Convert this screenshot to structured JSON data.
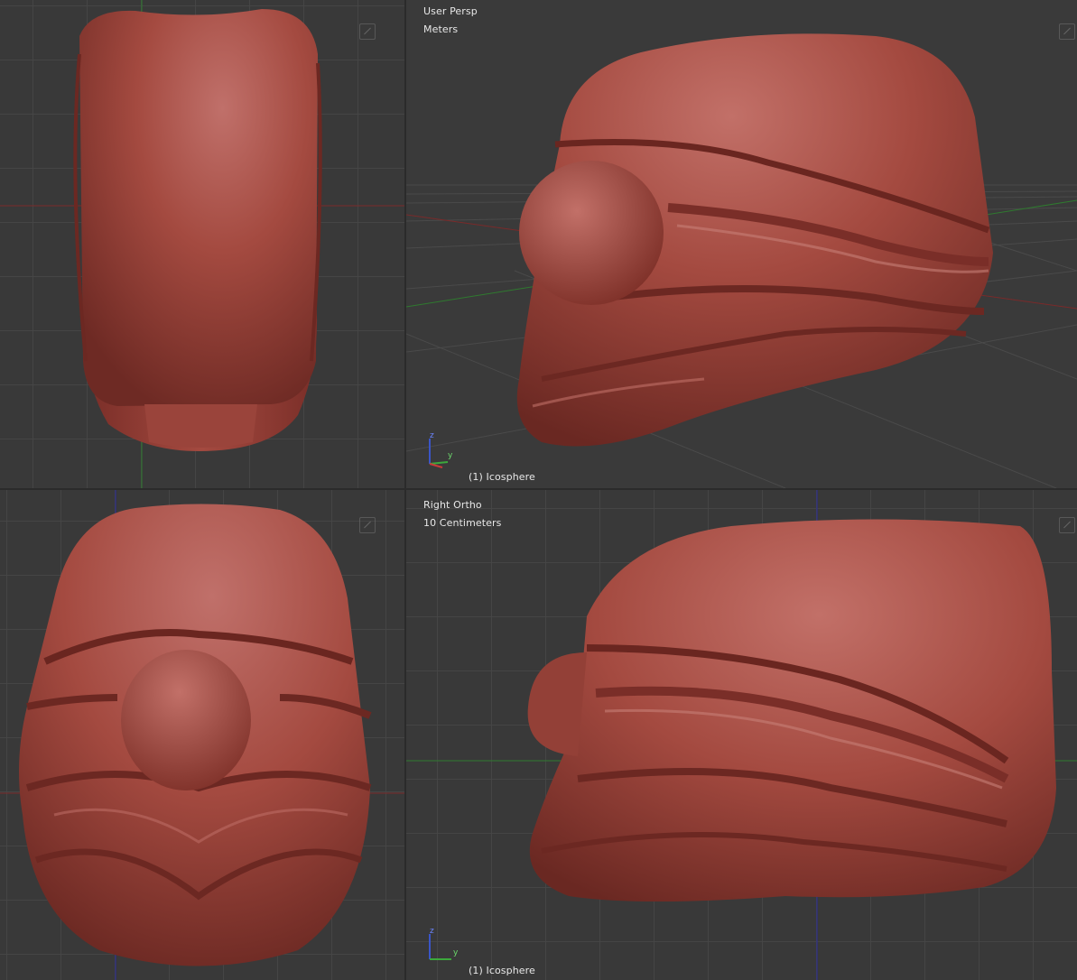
{
  "viewports": {
    "top_left": {
      "view_name": "",
      "object_name": ""
    },
    "top_right": {
      "view_name": "User Persp",
      "units": "Meters",
      "object_name": "(1) Icosphere",
      "axis_z": "z",
      "axis_y": "y"
    },
    "bottom_left": {
      "view_name": "",
      "object_name": ""
    },
    "bottom_right": {
      "view_name": "Right Ortho",
      "units": "10 Centimeters",
      "object_name": "(1) Icosphere",
      "axis_z": "z",
      "axis_y": "y"
    }
  },
  "colors": {
    "viewport_bg": "#393939",
    "grid_line": "#464646",
    "x_axis": "#8a2a2a",
    "y_axis": "#2f8a2f",
    "z_axis": "#2a2a9a",
    "sculpt_material": "#a44a40"
  },
  "icons": {
    "corner_widget": "viewport-split-icon",
    "axis_gizmo": "axis-gizmo-icon"
  }
}
